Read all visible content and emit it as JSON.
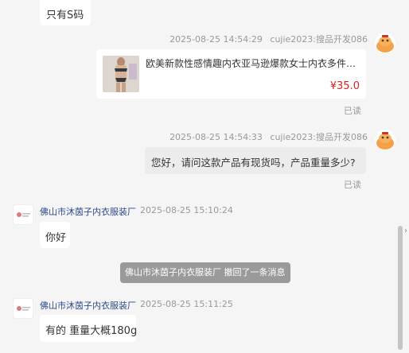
{
  "messages": {
    "m0": {
      "text": "只有S码"
    },
    "m1": {
      "timestamp": "2025-08-25 14:54:29",
      "sender": "cujie2023:搜品开发086",
      "product_title": "欧美新款性感情趣内衣亚马逊爆款女士内衣多件套透视...",
      "price": "¥35.0",
      "status": "已读"
    },
    "m2": {
      "timestamp": "2025-08-25 14:54:33",
      "sender": "cujie2023:搜品开发086",
      "text": "您好，请问这款产品有现货吗，产品重量多少?",
      "status": "已读"
    },
    "m3": {
      "shop": "佛山市沐茵子内衣服装厂",
      "timestamp": "2025-08-25 15:10:24",
      "text": "你好"
    },
    "recall": {
      "text": "佛山市沐茵子内衣服装厂 撤回了一条消息"
    },
    "m4": {
      "shop": "佛山市沐茵子内衣服装厂",
      "timestamp": "2025-08-25 15:11:25",
      "text": "有的 重量大概180g"
    }
  },
  "colors": {
    "background": "#f5f5f5",
    "bubble_self": "#ececec",
    "bubble_other": "#ffffff",
    "price": "#e02020",
    "shop_name": "#2c4a8c",
    "recall_bg": "#9a9a9a",
    "avatar_orange": "#f4a14a"
  },
  "icons": {
    "self_avatar": "cartoon-face-icon",
    "shop_avatar": "shop-logo-icon",
    "product_image": "lingerie-product-thumbnail"
  }
}
